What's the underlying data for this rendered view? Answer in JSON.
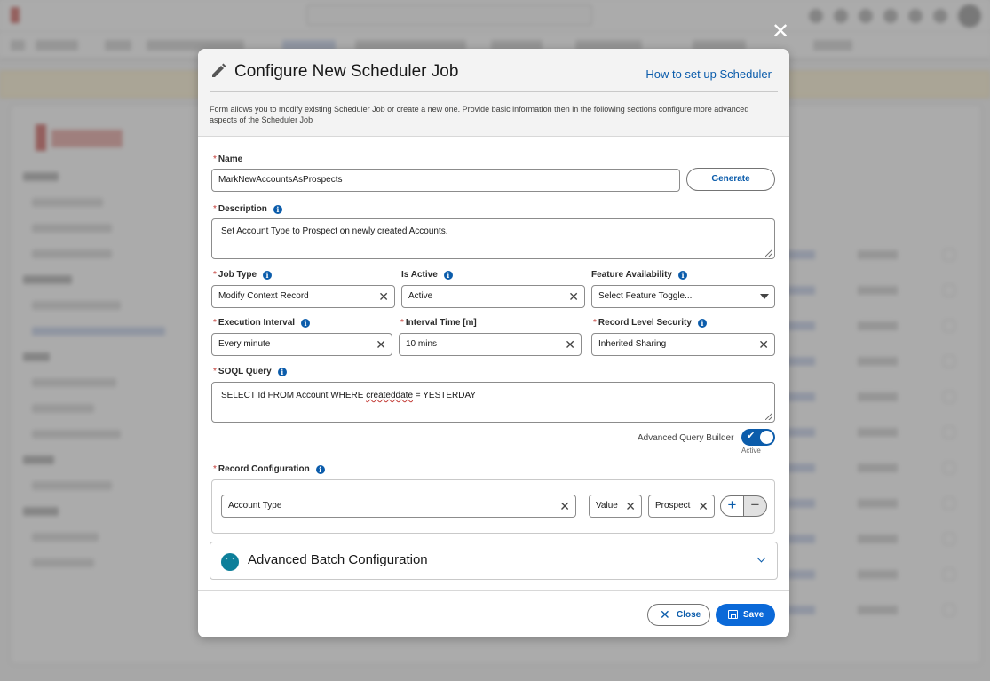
{
  "modal": {
    "title": "Configure New Scheduler Job",
    "help_link": "How to set up Scheduler",
    "description": "Form allows you to modify existing Scheduler Job or create a new one. Provide basic information then in the following sections configure more advanced aspects of the Scheduler Job",
    "close_icon": "close-icon",
    "title_icon": "pencil-icon"
  },
  "form": {
    "name": {
      "label": "Name",
      "value": "MarkNewAccountsAsProspects",
      "generate_label": "Generate"
    },
    "description": {
      "label": "Description",
      "value": "Set Account Type to Prospect on newly created Accounts."
    },
    "job_type": {
      "label": "Job Type",
      "value": "Modify Context Record"
    },
    "is_active": {
      "label": "Is Active",
      "value": "Active"
    },
    "feature_availability": {
      "label": "Feature Availability",
      "placeholder": "Select Feature Toggle..."
    },
    "execution_interval": {
      "label": "Execution Interval",
      "value": "Every minute"
    },
    "interval_time": {
      "label": "Interval Time [m]",
      "value": "10 mins"
    },
    "record_level_security": {
      "label": "Record Level Security",
      "value": "Inherited Sharing"
    },
    "soql_query": {
      "label": "SOQL Query",
      "value_before": "SELECT Id FROM Account WHERE ",
      "value_misspelled": "createddate",
      "value_after": " = YESTERDAY"
    },
    "advanced_query_builder": {
      "label": "Advanced Query Builder",
      "state": "Active",
      "enabled": true
    },
    "record_configuration": {
      "label": "Record Configuration",
      "field": "Account Type",
      "operator": "Value",
      "value": "Prospect",
      "add_symbol": "+",
      "remove_symbol": "−"
    }
  },
  "accordion": {
    "title": "Advanced Batch Configuration",
    "icon": "batch-icon",
    "expanded": false
  },
  "footer": {
    "close_label": "Close",
    "save_label": "Save"
  },
  "colors": {
    "brand": "#0b5cab",
    "required": "#c23934",
    "save_button": "#0b69d8"
  }
}
